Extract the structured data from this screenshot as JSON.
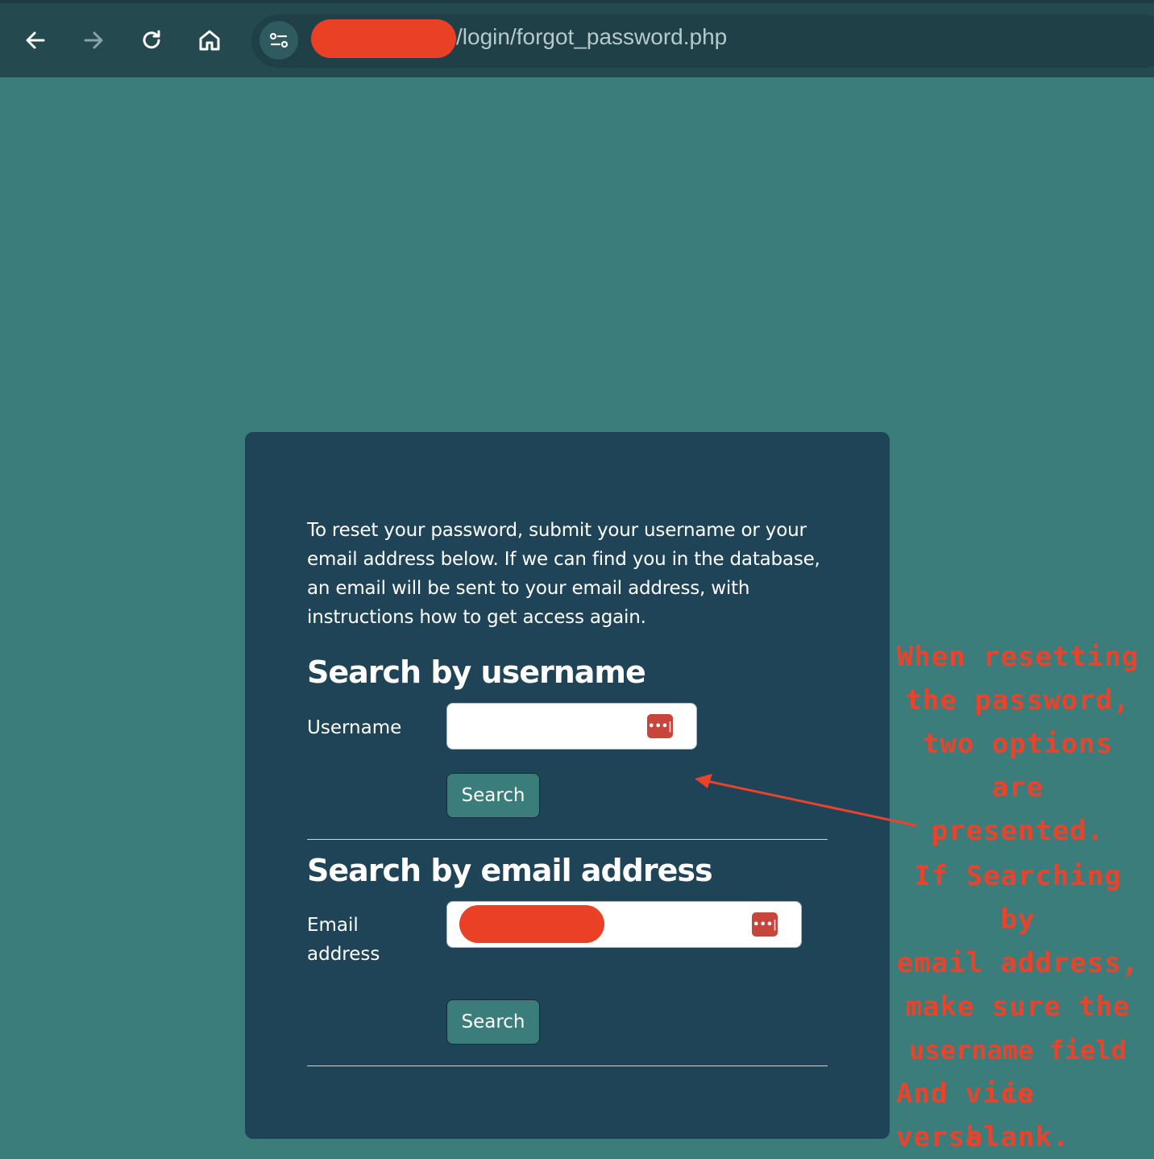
{
  "browser": {
    "url_path": "/login/forgot_password.php",
    "icons": [
      "back-arrow-icon",
      "forward-arrow-icon",
      "reload-icon",
      "home-icon",
      "site-settings-icon"
    ]
  },
  "form": {
    "intro_text": "To reset your password, submit your username or your email address below. If we can find you in the database, an email will be sent to your email address, with instructions how to get access again.",
    "username_section": {
      "heading": "Search by username",
      "label": "Username",
      "value": "",
      "button_label": "Search"
    },
    "email_section": {
      "heading": "Search by email address",
      "label_line1": "Email",
      "label_line2": "address",
      "button_label": "Search"
    },
    "password_manager_icon": "•••|"
  },
  "annotations": {
    "note1": [
      "When resetting",
      "the password,",
      "two options are",
      "presented."
    ],
    "note2": [
      "If Searching by",
      "email address,",
      "make sure the",
      "username field is",
      "blank."
    ],
    "note3": "And vice versa."
  },
  "colors": {
    "page_bg": "#3a7d7b",
    "card_bg": "#1f4458",
    "redaction": "#e94026",
    "annotation": "#e9432c"
  }
}
